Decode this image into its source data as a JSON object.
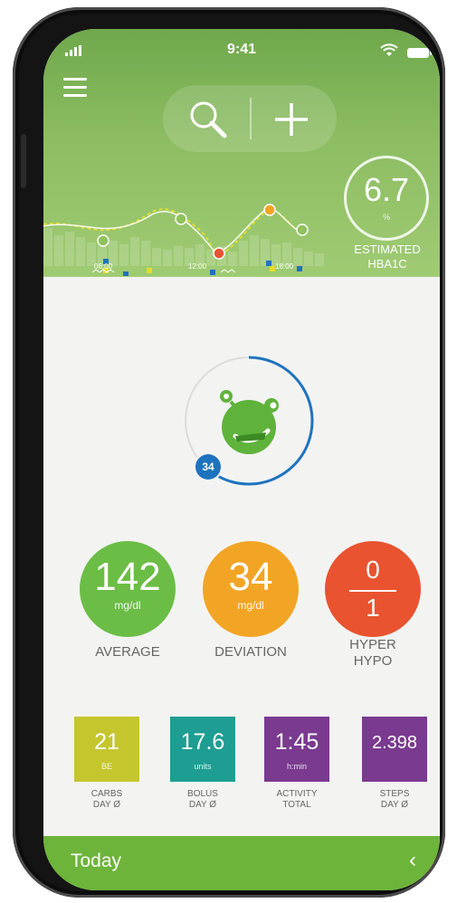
{
  "status_bar": {
    "time": "9:41"
  },
  "header": {
    "chart_times": [
      "06:00",
      "12:00",
      "18:00"
    ],
    "hba1c": {
      "value": "6.7",
      "unit": "%",
      "label_line1": "ESTIMATED",
      "label_line2": "HBA1C"
    }
  },
  "center": {
    "ring_badge": "34",
    "ring_progress": 0.6
  },
  "stats": [
    {
      "value": "142",
      "unit": "mg/dl",
      "label": "AVERAGE",
      "color": "#6bbd45"
    },
    {
      "value": "34",
      "unit": "mg/dl",
      "label": "DEVIATION",
      "color": "#f2a524"
    },
    {
      "numerator": "0",
      "denominator": "1",
      "label_line1": "HYPER",
      "label_line2": "HYPO",
      "color": "#e9532f"
    }
  ],
  "tiles": [
    {
      "value": "21",
      "unit": "BE",
      "label_line1": "CARBS",
      "label_line2": "DAY Ø",
      "color": "#c5c62e"
    },
    {
      "value": "17.6",
      "unit": "units",
      "label_line1": "BOLUS",
      "label_line2": "DAY Ø",
      "color": "#1e9e93"
    },
    {
      "value": "1:45",
      "unit": "h:min",
      "label_line1": "ACTIVITY",
      "label_line2": "TOTAL",
      "color": "#7a3a8f"
    },
    {
      "value": "2.398",
      "unit": "",
      "label_line1": "STEPS",
      "label_line2": "DAY Ø",
      "color": "#7a3a8f"
    }
  ],
  "footer": {
    "title": "Today",
    "chevron": "chevron-left-icon"
  },
  "icons": [
    "menu-icon",
    "search-icon",
    "plus-icon",
    "signal-icon",
    "wifi-icon",
    "battery-icon",
    "monster-avatar-icon"
  ]
}
